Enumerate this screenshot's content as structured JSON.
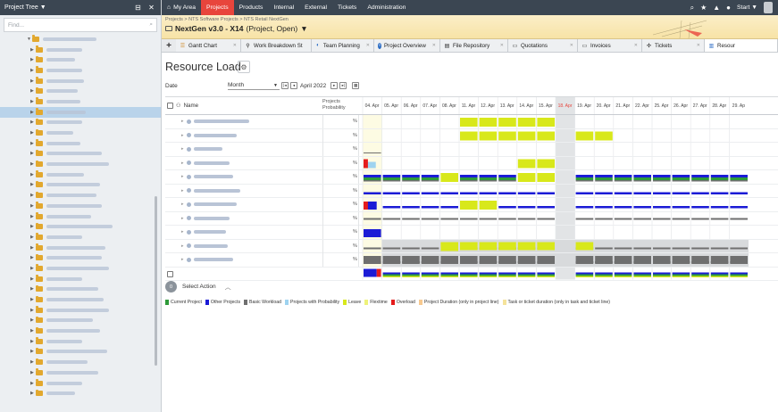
{
  "sidebar": {
    "title": "Project Tree",
    "search_placeholder": "Find..."
  },
  "topnav": {
    "items": [
      "My Area",
      "Projects",
      "Products",
      "Internal",
      "External",
      "Tickets",
      "Administration"
    ],
    "active": "Projects",
    "start_label": "Start"
  },
  "project": {
    "breadcrumb": "Projects > NTS Software Projects > NTS Retail NextGen",
    "name": "NextGen v3.0 - X14",
    "status": "(Project, Open)"
  },
  "tabs": [
    {
      "label": "Gantt Chart",
      "icon": "gantt-icon"
    },
    {
      "label": "Work Breakdown St",
      "icon": "wbs-icon"
    },
    {
      "label": "Team Planning",
      "icon": "team-icon"
    },
    {
      "label": "Project Overview",
      "icon": "info-icon"
    },
    {
      "label": "File Repository",
      "icon": "file-icon"
    },
    {
      "label": "Quotations",
      "icon": "quote-icon"
    },
    {
      "label": "Invoices",
      "icon": "invoice-icon"
    },
    {
      "label": "Tickets",
      "icon": "ticket-icon"
    },
    {
      "label": "Resour",
      "icon": "resource-icon"
    }
  ],
  "page": {
    "title": "Resource Load",
    "date_label": "Date",
    "period": "Month",
    "date_value": "April 2022"
  },
  "grid": {
    "col_name": "Name",
    "col_prob": "Projects Probability",
    "days": [
      "04. Apr",
      "05. Apr",
      "06. Apr",
      "07. Apr",
      "08. Apr",
      "11. Apr",
      "12. Apr",
      "13. Apr",
      "14. Apr",
      "15. Apr",
      "18. Apr",
      "19. Apr",
      "20. Apr",
      "21. Apr",
      "22. Apr",
      "25. Apr",
      "26. Apr",
      "27. Apr",
      "28. Apr",
      "29. Ap"
    ],
    "holiday": "18. Apr",
    "pct_symbol": "%"
  },
  "action": {
    "count": "0",
    "label": "Select Action"
  },
  "legend": [
    {
      "label": "Current Project",
      "color": "#2e9b3a"
    },
    {
      "label": "Other Projects",
      "color": "#1b1bd6"
    },
    {
      "label": "Basic Workload",
      "color": "#6f6f6f"
    },
    {
      "label": "Projects with Probability",
      "color": "#9ed3f0"
    },
    {
      "label": "Leave",
      "color": "#d8e81b"
    },
    {
      "label": "Flextime",
      "color": "#eef27a"
    },
    {
      "label": "Overload",
      "color": "#e51c1c"
    },
    {
      "label": "Project Duration (only in project line)",
      "color": "#f7c98f"
    },
    {
      "label": "Task or ticket duration (only in task and ticket line)",
      "color": "#f5e39a"
    }
  ],
  "colors": {
    "accent": "#e8453c",
    "nav_bg": "#3b4652",
    "current": "#2e9b3a",
    "other": "#1b1bd6",
    "basic": "#6f6f6f",
    "leave": "#d8e81b",
    "overload": "#e51c1c",
    "prob": "#9ed3f0"
  }
}
